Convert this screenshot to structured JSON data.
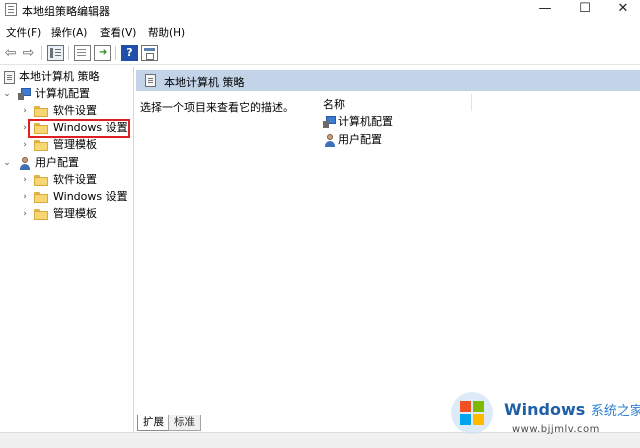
{
  "window": {
    "title": "本地组策略编辑器",
    "minimize_glyph": "—",
    "maximize_glyph": "☐",
    "close_glyph": "✕"
  },
  "menu": [
    "文件(F)",
    "操作(A)",
    "查看(V)",
    "帮助(H)"
  ],
  "toolbar": {
    "back_glyph": "⇦",
    "forward_glyph": "⇨",
    "help_glyph": "?"
  },
  "tree": {
    "root": "本地计算机 策略",
    "computer": {
      "label": "计算机配置",
      "children": [
        "软件设置",
        "Windows 设置",
        "管理模板"
      ]
    },
    "user": {
      "label": "用户配置",
      "children": [
        "软件设置",
        "Windows 设置",
        "管理模板"
      ]
    }
  },
  "content": {
    "header_title": "本地计算机 策略",
    "description": "选择一个项目来查看它的描述。",
    "column_name": "名称",
    "items": [
      "计算机配置",
      "用户配置"
    ]
  },
  "tabs": [
    "扩展",
    "标准"
  ],
  "highlight_color": "#e02020",
  "watermark": {
    "brand": "Windows",
    "cn_text": "系统之家",
    "url": "www.bjjmlv.com"
  }
}
